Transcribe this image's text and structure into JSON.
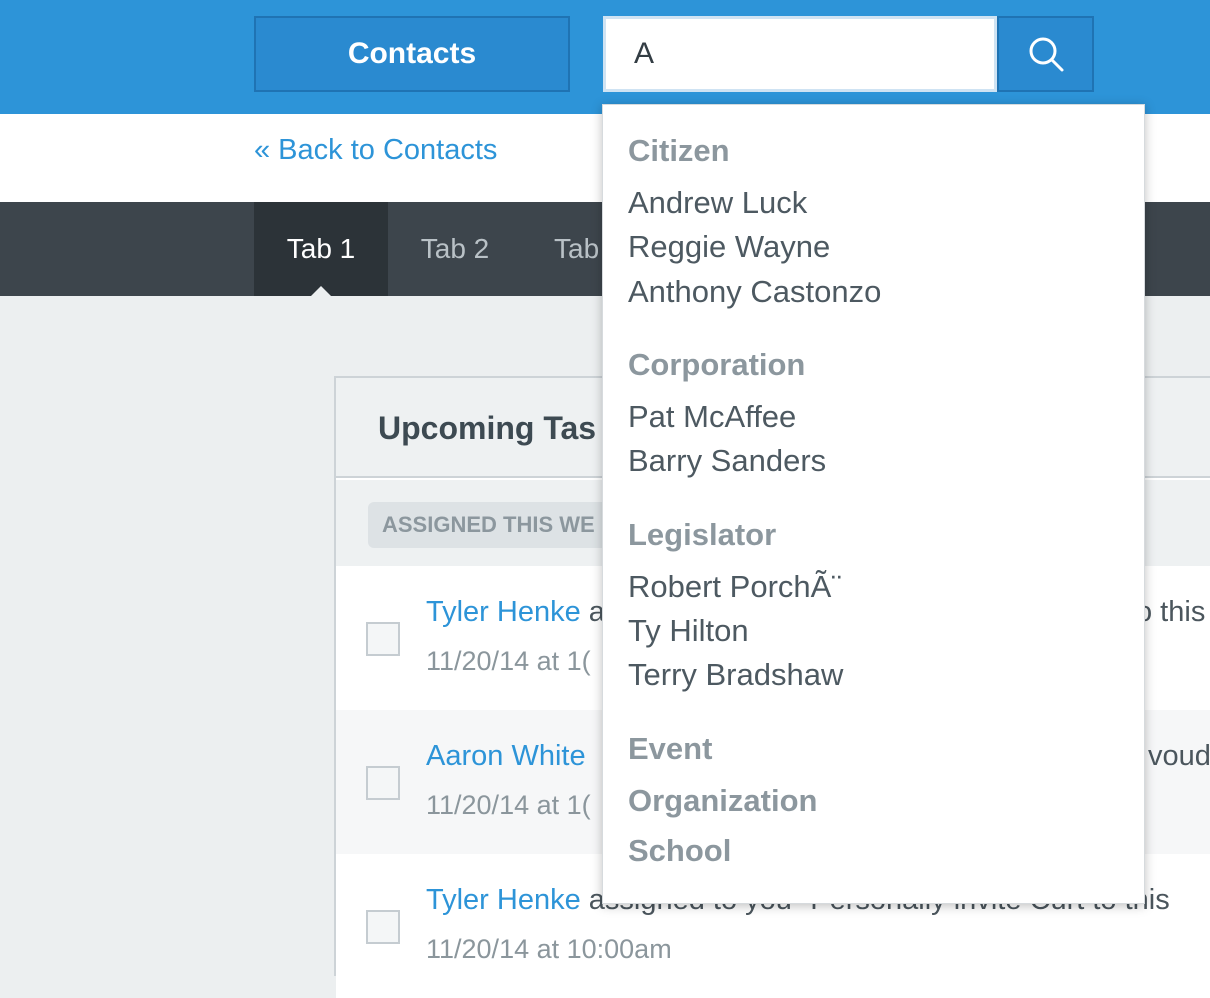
{
  "header": {
    "contacts_label": "Contacts",
    "search_value": "A"
  },
  "back_link": "« Back to Contacts",
  "tabs": [
    {
      "label": "Tab 1"
    },
    {
      "label": "Tab 2"
    },
    {
      "label": "Tab"
    }
  ],
  "panel": {
    "title": "Upcoming Tas",
    "section_label": "ASSIGNED THIS WE",
    "tasks": [
      {
        "person": "Tyler Henke",
        "text_start": " a",
        "text_end": "o this",
        "date": "11/20/14 at 1("
      },
      {
        "person": "Aaron White",
        "text_start": "",
        "text_end": "voud",
        "date": "11/20/14 at 1("
      },
      {
        "person": "Tyler Henke",
        "text_start": " assigned to you \"Personally invite Curt to this",
        "text_end": "",
        "date": "11/20/14 at 10:00am"
      }
    ]
  },
  "dropdown": {
    "groups": [
      {
        "label": "Citizen",
        "items": [
          "Andrew Luck",
          "Reggie Wayne",
          "Anthony Castonzo"
        ]
      },
      {
        "label": "Corporation",
        "items": [
          "Pat McAffee",
          "Barry Sanders"
        ]
      },
      {
        "label": "Legislator",
        "items": [
          "Robert PorchÃ¨",
          "Ty Hilton",
          "Terry Bradshaw"
        ]
      },
      {
        "label": "Event",
        "items": []
      },
      {
        "label": "Organization",
        "items": []
      },
      {
        "label": "School",
        "items": []
      }
    ]
  },
  "colors": {
    "header_blue": "#2d94d8",
    "link_blue": "#2d94d8",
    "tabbar": "#3d454c",
    "active_tab": "#2c3338"
  }
}
